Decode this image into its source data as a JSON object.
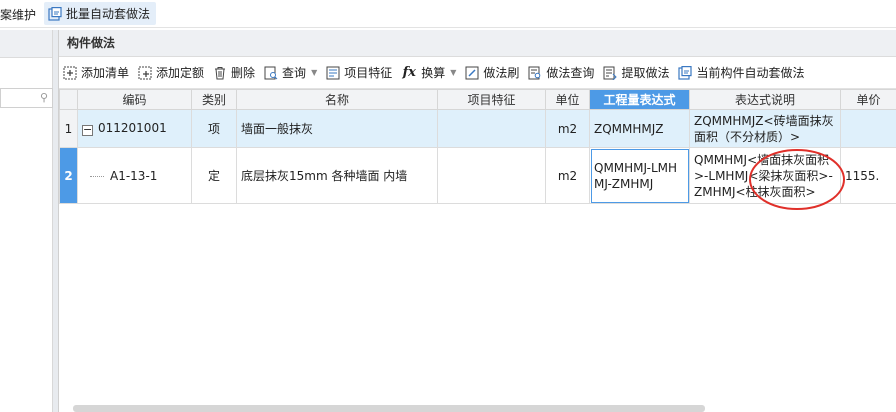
{
  "topbar": {
    "left_label": "案维护",
    "batch_button": "批量自动套做法"
  },
  "panel": {
    "title": "构件做法"
  },
  "toolbar": {
    "items": [
      {
        "label": "添加清单",
        "icon": "add-list-icon"
      },
      {
        "label": "添加定额",
        "icon": "add-quota-icon"
      },
      {
        "label": "删除",
        "icon": "trash-icon"
      },
      {
        "label": "查询",
        "icon": "query-icon"
      },
      {
        "label": "项目特征",
        "icon": "feature-icon"
      },
      {
        "label": "换算",
        "icon": "fx-icon"
      },
      {
        "label": "做法刷",
        "icon": "brush-icon"
      },
      {
        "label": "做法查询",
        "icon": "method-query-icon"
      },
      {
        "label": "提取做法",
        "icon": "extract-icon"
      },
      {
        "label": "当前构件自动套做法",
        "icon": "auto-apply-icon"
      }
    ]
  },
  "table": {
    "headers": [
      "编码",
      "类别",
      "名称",
      "项目特征",
      "单位",
      "工程量表达式",
      "表达式说明",
      "单价"
    ],
    "rows": [
      {
        "no": "1",
        "code": "011201001",
        "category": "项",
        "name": "墙面一般抹灰",
        "feature": "",
        "unit": "m2",
        "expression": "ZQMMHMJZ",
        "explanation": "ZQMMHMJZ<砖墙面抹灰面积（不分材质）>",
        "price": ""
      },
      {
        "no": "2",
        "code": "A1-13-1",
        "category": "定",
        "name": "底层抹灰15mm 各种墙面 内墙",
        "feature": "",
        "unit": "m2",
        "expression": "QMMHMJ-LMHMJ-ZMHMJ",
        "explanation": "QMMHMJ<墙面抹灰面积>-LMHMJ<梁抹灰面积>-ZMHMJ<柱抹灰面积>",
        "price": "1155."
      }
    ]
  },
  "colors": {
    "accent": "#4d9ae6",
    "selected_row": "#dff0fb",
    "annotation": "#e0302a"
  }
}
